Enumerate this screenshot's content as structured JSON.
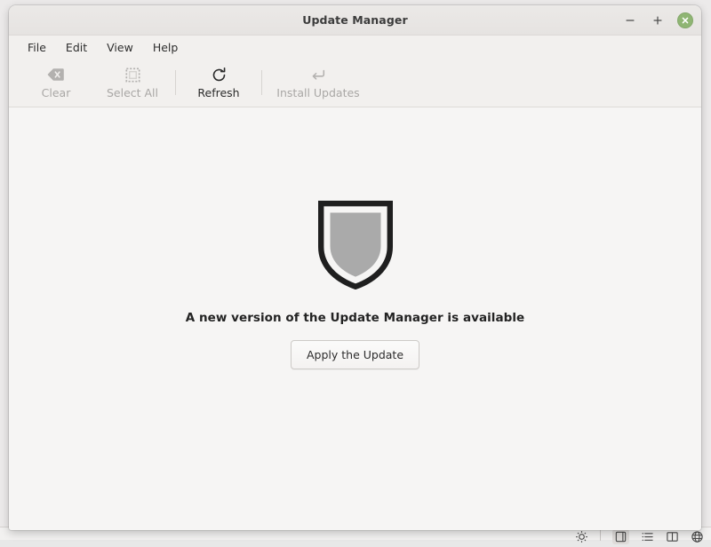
{
  "window": {
    "title": "Update Manager",
    "controls": {
      "minimize_label": "–",
      "minimize_icon": "minimize-icon",
      "maximize_label": "+",
      "maximize_icon": "maximize-icon",
      "close_icon": "close-icon",
      "close_color": "#8fb573"
    }
  },
  "menubar": {
    "items": [
      {
        "label": "File"
      },
      {
        "label": "Edit"
      },
      {
        "label": "View"
      },
      {
        "label": "Help"
      }
    ]
  },
  "toolbar": {
    "buttons": [
      {
        "label": "Clear",
        "icon": "clear-backspace-icon",
        "enabled": false
      },
      {
        "label": "Select All",
        "icon": "select-all-dashed-square-icon",
        "enabled": false
      },
      {
        "label": "Refresh",
        "icon": "refresh-circular-arrow-icon",
        "enabled": true
      },
      {
        "label": "Install Updates",
        "icon": "install-enter-arrow-icon",
        "enabled": false
      }
    ]
  },
  "content": {
    "icon": "shield-icon",
    "shield_colors": {
      "border": "#1f1f1f",
      "gap": "#ffffff",
      "fill": "#aaaaaa"
    },
    "message": "A new version of the Update Manager is available",
    "apply_button_label": "Apply the Update"
  },
  "taskbar": {
    "icons": [
      {
        "name": "brightness-icon",
        "active": false
      },
      {
        "name": "separator",
        "active": false
      },
      {
        "name": "window-preview-icon",
        "active": true
      },
      {
        "name": "list-icon",
        "active": false
      },
      {
        "name": "book-icon",
        "active": false
      },
      {
        "name": "globe-icon",
        "active": false
      }
    ]
  }
}
